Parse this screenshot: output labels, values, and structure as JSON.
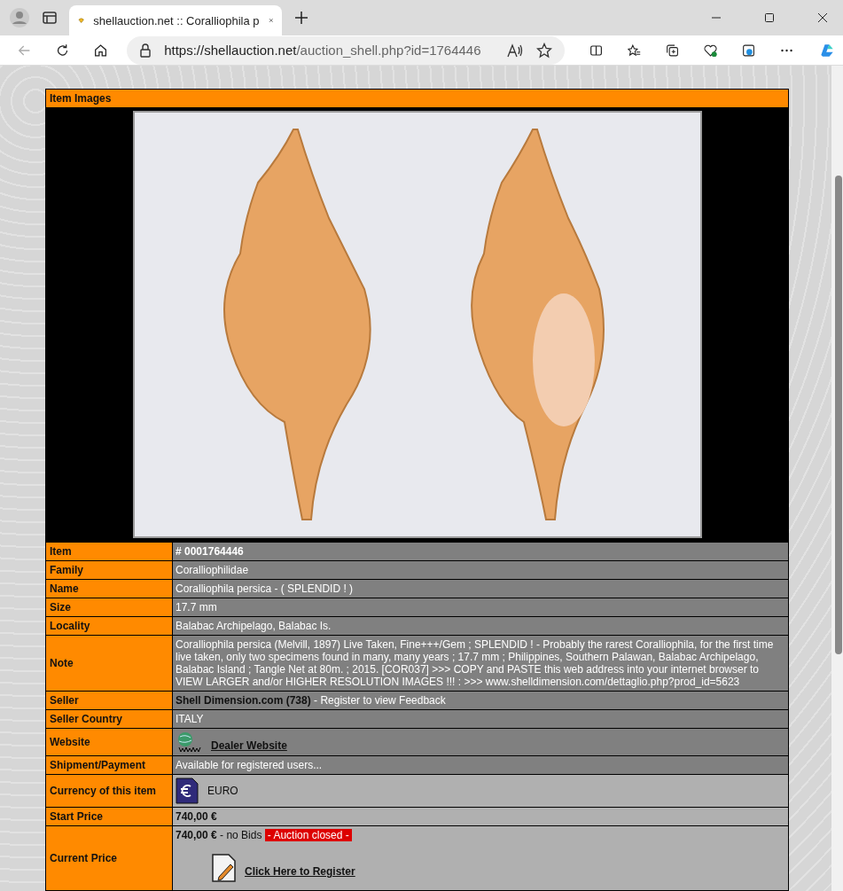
{
  "browser": {
    "tab_title": "shellauction.net :: Coralliophila p",
    "url_host": "https://shellauction.net",
    "url_path": "/auction_shell.php?id=1764446"
  },
  "images_header": "Item Images",
  "rows": [
    {
      "kind": "text",
      "label": "Item",
      "light": false,
      "bold": true,
      "value": "# 0001764446"
    },
    {
      "kind": "text",
      "label": "Family",
      "light": false,
      "bold": false,
      "value": "Coralliophilidae"
    },
    {
      "kind": "text",
      "label": "Name",
      "light": false,
      "bold": false,
      "value": "Coralliophila persica - ( SPLENDID ! )"
    },
    {
      "kind": "text",
      "label": "Size",
      "light": false,
      "bold": false,
      "value": "17.7 mm"
    },
    {
      "kind": "text",
      "label": "Locality",
      "light": false,
      "bold": false,
      "value": "Balabac Archipelago, Balabac Is."
    },
    {
      "kind": "text",
      "label": "Note",
      "light": false,
      "bold": false,
      "value": "Coralliophila persica (Melvill, 1897) Live Taken, Fine+++/Gem ; SPLENDID ! - Probably the rarest Coralliophila, for the first time live taken, only two specimens found in many, many years ; 17.7 mm ; Philippines, Southern Palawan, Balabac Archipelago, Balabac Island ; Tangle Net at 80m. ; 2015. [COR037] >>> COPY and PASTE this web address into your internet browser to VIEW LARGER and/or HIGHER RESOLUTION IMAGES !!! : >>> www.shelldimension.com/dettaglio.php?prod_id=5623"
    },
    {
      "kind": "seller",
      "label": "Seller",
      "light": false,
      "name": "Shell Dimension.com (738)",
      "note": "- Register to view Feedback"
    },
    {
      "kind": "text",
      "label": "Seller Country",
      "light": false,
      "bold": false,
      "value": "ITALY"
    },
    {
      "kind": "website",
      "label": "Website",
      "light": false,
      "link": "Dealer Website"
    },
    {
      "kind": "text",
      "label": "Shipment/Payment",
      "light": false,
      "bold": false,
      "value": "Available for registered users..."
    },
    {
      "kind": "currency",
      "label": "Currency of this item",
      "light": true,
      "value": "EURO"
    },
    {
      "kind": "text",
      "label": "Start Price",
      "light": true,
      "bold": true,
      "value": "740,00 €"
    },
    {
      "kind": "current",
      "label": "Current Price",
      "light": true,
      "price": "740,00 €",
      "bids": "- no Bids",
      "status": "- Auction closed -",
      "link": "Click Here to Register"
    }
  ]
}
